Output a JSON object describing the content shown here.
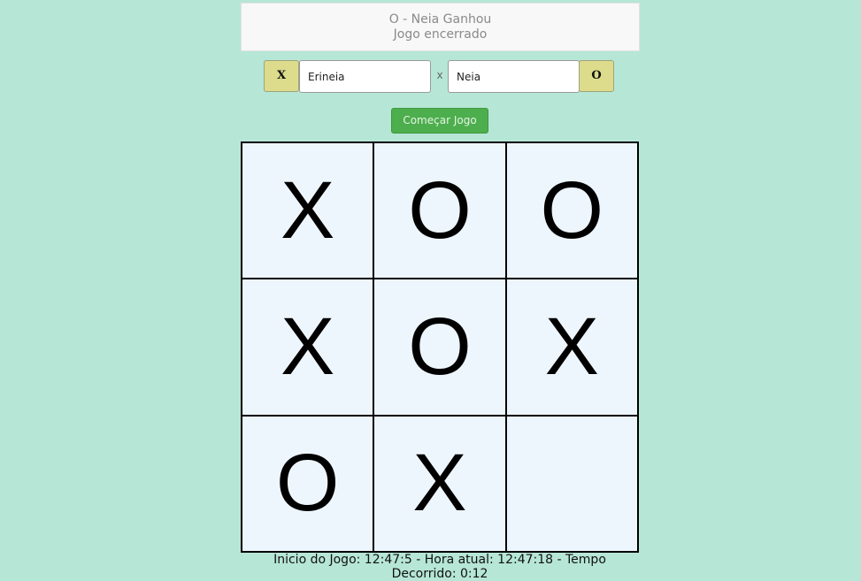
{
  "status": {
    "line1": "O - Neia Ganhou",
    "line2": "Jogo encerrado"
  },
  "players": {
    "player1": {
      "symbol": "X",
      "name": "Erineia"
    },
    "separator": "x",
    "player2": {
      "symbol": "O",
      "name": "Neia"
    }
  },
  "start_button": {
    "label": "Começar Jogo"
  },
  "board": {
    "cells": [
      "X",
      "O",
      "O",
      "X",
      "O",
      "X",
      "O",
      "X",
      ""
    ]
  },
  "timer": {
    "text": "Inicio do Jogo: 12:47:5 - Hora atual: 12:47:18 - Tempo Decorrido: 0:12"
  },
  "colors": {
    "background": "#b6e6d6",
    "symbol_button": "#dcdc8c",
    "start_button": "#4cae4c",
    "cell": "#eef6fd"
  }
}
